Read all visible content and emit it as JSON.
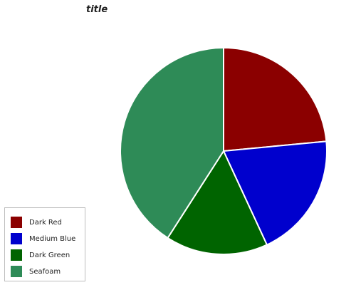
{
  "chart_data": {
    "type": "pie",
    "title": "title",
    "categories": [
      "Dark Red",
      "Medium Blue",
      "Dark Green",
      "Seafoam"
    ],
    "values": [
      23.5,
      19.6,
      16.0,
      40.9
    ],
    "colors": [
      "#8b0000",
      "#0000cd",
      "#006400",
      "#2e8b57"
    ],
    "legend_position": "bottom-left",
    "start_angle_deg": 90,
    "direction": "clockwise"
  }
}
